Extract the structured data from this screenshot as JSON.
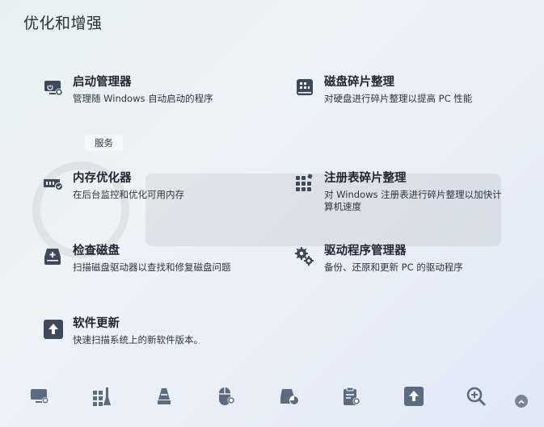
{
  "header": {
    "title": "优化和增强"
  },
  "section_tag": "服务",
  "tools": [
    {
      "id": "startup",
      "name": "启动管理器",
      "desc": "管理随 Windows 自动启动的程序",
      "icon": "monitor-gear-icon"
    },
    {
      "id": "defrag",
      "name": "磁盘碎片整理",
      "desc": "对硬盘进行碎片整理以提高 PC 性能",
      "icon": "disk-defrag-icon"
    },
    {
      "id": "memory",
      "name": "内存优化器",
      "desc": "在后台监控和优化可用内存",
      "icon": "memory-check-icon"
    },
    {
      "id": "registry",
      "name": "注册表碎片整理",
      "desc_lines": [
        "对 Windows 注册表进行碎片整理以加快计",
        "算机速度"
      ],
      "icon": "registry-blocks-icon"
    },
    {
      "id": "checkdisk",
      "name": "检查磁盘",
      "desc": "扫描磁盘驱动器以查找和修复磁盘问题",
      "icon": "disk-plus-icon"
    },
    {
      "id": "driver",
      "name": "驱动程序管理器",
      "desc": "备份、还原和更新 PC 的驱动程序",
      "icon": "gears-icon"
    },
    {
      "id": "update",
      "name": "软件更新",
      "desc": "快速扫描系统上的新软件版本。",
      "icon": "upload-arrow-icon"
    }
  ],
  "bottom_bar": [
    "monitor-gear-icon",
    "blocks-cleaner-icon",
    "disk-cone-icon",
    "mouse-gear-icon",
    "disk-pie-icon",
    "clipboard-gear-icon",
    "upload-arrow-icon",
    "search-plus-icon"
  ],
  "colors": {
    "icon": "#3d4a5c",
    "accent": "#5b6b80"
  }
}
